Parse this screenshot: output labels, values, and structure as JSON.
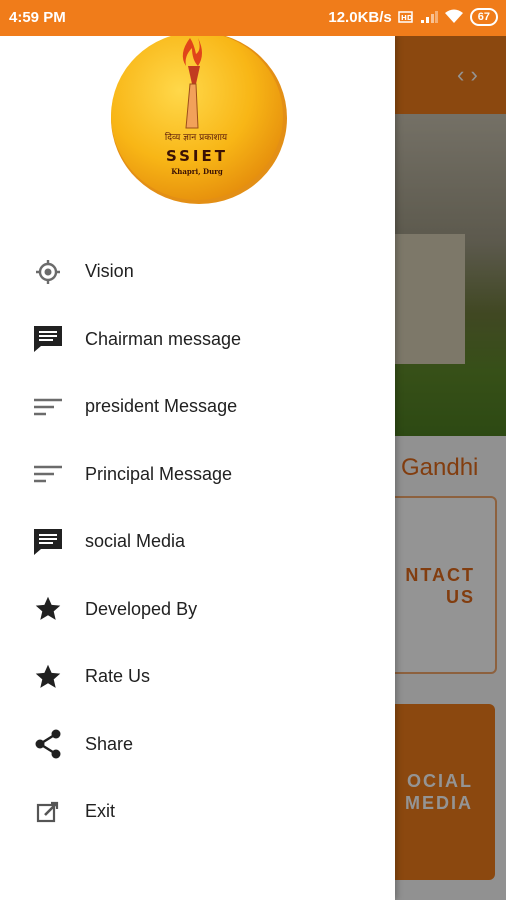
{
  "status_bar": {
    "time": "4:59 PM",
    "net_speed": "12.0KB/s",
    "battery": "67"
  },
  "logo": {
    "hindi_text": "दिव्य ज्ञान प्रकाशाय",
    "name": "SSIET",
    "location": "Khapri, Durg"
  },
  "menu": [
    {
      "label": "Vision",
      "icon": "crosshair-icon"
    },
    {
      "label": "Chairman message",
      "icon": "message-icon"
    },
    {
      "label": "president Message",
      "icon": "sort-lines-icon"
    },
    {
      "label": "Principal Message",
      "icon": "sort-lines-icon"
    },
    {
      "label": "social Media",
      "icon": "message-icon"
    },
    {
      "label": "Developed By",
      "icon": "star-icon"
    },
    {
      "label": "Rate Us",
      "icon": "star-icon"
    },
    {
      "label": "Share",
      "icon": "share-icon"
    },
    {
      "label": "Exit",
      "icon": "edit-icon"
    }
  ],
  "background": {
    "heading": "Gandhi",
    "card1": "NTACT US",
    "card2": "OCIAL MEDIA"
  },
  "colors": {
    "primary": "#f07c1a",
    "icon": "#212121"
  }
}
